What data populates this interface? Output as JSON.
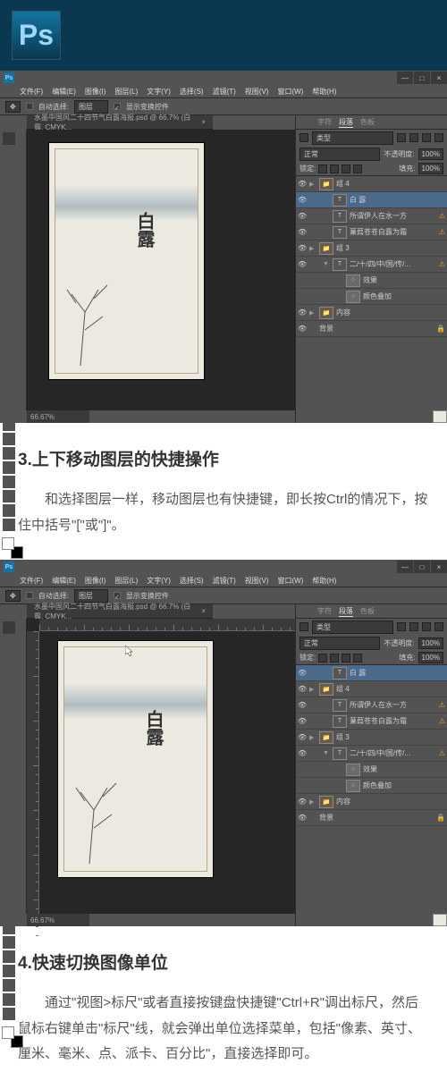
{
  "logo": "Ps",
  "menus": [
    "文件(F)",
    "编辑(E)",
    "图像(I)",
    "图层(L)",
    "文字(Y)",
    "选择(S)",
    "滤镜(T)",
    "视图(V)",
    "窗口(W)",
    "帮助(H)"
  ],
  "options": {
    "auto_select": "自动选择:",
    "layer_dd": "图层",
    "show_controls": "显示变换控件"
  },
  "doc_tab": "水墨中国风二十四节气白露海报.psd @ 66.7% (白 露, CMYK...",
  "doc_close": "×",
  "zoom": "66.67%",
  "artwork_title": "白露",
  "panels": {
    "tabs": [
      "字符",
      "段落",
      "色板"
    ],
    "kind": "类型",
    "blend": "正常",
    "opacity_label": "不透明度:",
    "opacity": "100%",
    "lock_label": "锁定:",
    "fill_label": "填充:",
    "fill": "100%"
  },
  "layers1": [
    {
      "eye": "●",
      "exp": "▶",
      "icon": "folder",
      "name": "组 4",
      "sel": false,
      "indent": 0
    },
    {
      "eye": "●",
      "exp": "",
      "icon": "text",
      "name": "白 露",
      "sel": true,
      "indent": 1
    },
    {
      "eye": "●",
      "exp": "",
      "icon": "text",
      "name": "所谓伊人在水一方",
      "sel": false,
      "indent": 1
    },
    {
      "eye": "●",
      "exp": "",
      "icon": "text",
      "name": "蒹葭苍苍白露为霜",
      "sel": false,
      "indent": 1
    },
    {
      "eye": "●",
      "exp": "▶",
      "icon": "folder",
      "name": "组 3",
      "sel": false,
      "indent": 0
    },
    {
      "eye": "●",
      "exp": "▼",
      "icon": "text",
      "name": "二/十/四/中/国/传/...",
      "sel": false,
      "indent": 1
    },
    {
      "eye": "",
      "exp": "",
      "icon": "fx",
      "name": "效果",
      "sel": false,
      "indent": 2
    },
    {
      "eye": "",
      "exp": "",
      "icon": "fx",
      "name": "颜色叠加",
      "sel": false,
      "indent": 2
    },
    {
      "eye": "●",
      "exp": "▶",
      "icon": "folder",
      "name": "内容",
      "sel": false,
      "indent": 0
    },
    {
      "eye": "●",
      "exp": "",
      "icon": "bg",
      "name": "背景",
      "sel": false,
      "indent": 0
    }
  ],
  "layers2": [
    {
      "eye": "●",
      "exp": "",
      "icon": "text",
      "name": "白 露",
      "sel": true,
      "indent": 1
    },
    {
      "eye": "●",
      "exp": "▶",
      "icon": "folder",
      "name": "组 4",
      "sel": false,
      "indent": 0
    },
    {
      "eye": "●",
      "exp": "",
      "icon": "text",
      "name": "所谓伊人在水一方",
      "sel": false,
      "indent": 1
    },
    {
      "eye": "●",
      "exp": "",
      "icon": "text",
      "name": "蒹葭苍苍白露为霜",
      "sel": false,
      "indent": 1
    },
    {
      "eye": "●",
      "exp": "▶",
      "icon": "folder",
      "name": "组 3",
      "sel": false,
      "indent": 0
    },
    {
      "eye": "●",
      "exp": "▼",
      "icon": "text",
      "name": "二/十/四/中/国/传/...",
      "sel": false,
      "indent": 1
    },
    {
      "eye": "",
      "exp": "",
      "icon": "fx",
      "name": "效果",
      "sel": false,
      "indent": 2
    },
    {
      "eye": "",
      "exp": "",
      "icon": "fx",
      "name": "颜色叠加",
      "sel": false,
      "indent": 2
    },
    {
      "eye": "●",
      "exp": "▶",
      "icon": "folder",
      "name": "内容",
      "sel": false,
      "indent": 0
    },
    {
      "eye": "●",
      "exp": "",
      "icon": "bg",
      "name": "背景",
      "sel": false,
      "indent": 0
    }
  ],
  "section3": {
    "title": "3.上下移动图层的快捷操作",
    "body": "和选择图层一样，移动图层也有快捷键，即长按Ctrl的情况下，按住中括号\"[\"或\"]\"。"
  },
  "section4": {
    "title": "4.快速切换图像单位",
    "body": "通过\"视图>标尺\"或者直接按键盘快捷键\"Ctrl+R\"调出标尺，然后鼠标右键单击\"标尺\"线，就会弹出单位选择菜单，包括\"像素、英寸、厘米、毫米、点、派卡、百分比\"，直接选择即可。"
  }
}
